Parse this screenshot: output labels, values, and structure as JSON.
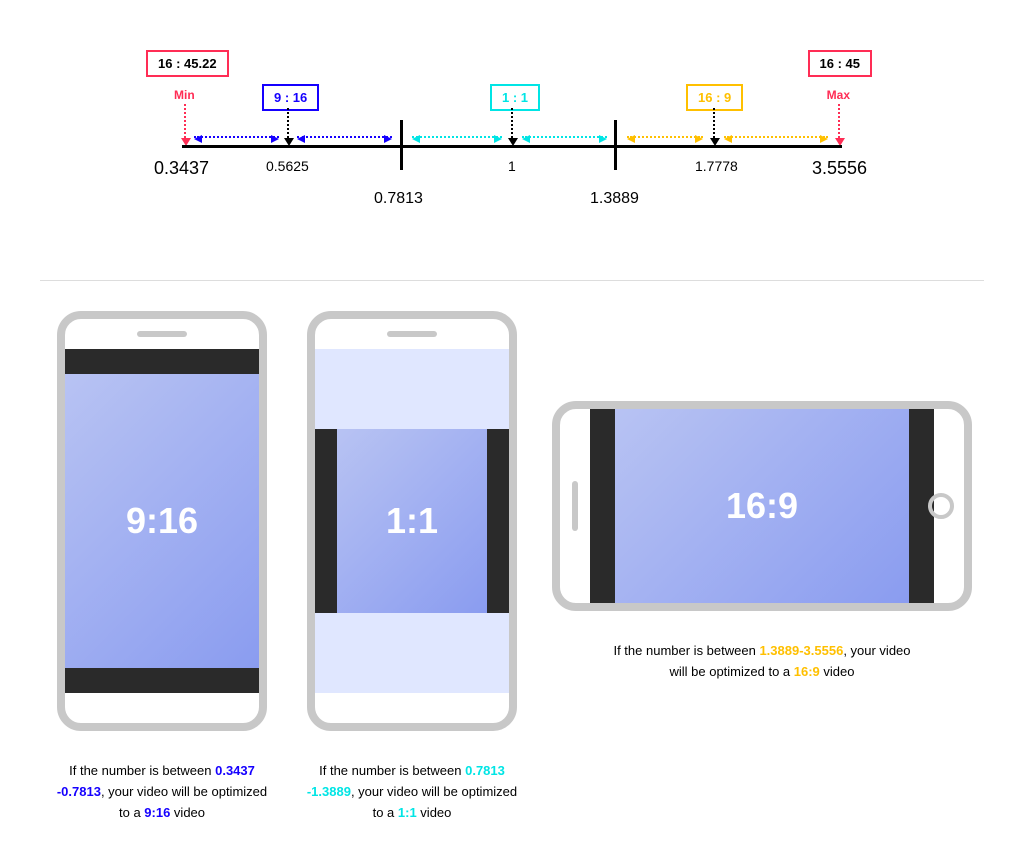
{
  "numberline": {
    "min_box": "16 : 45.22",
    "max_box": "16 : 45",
    "min_label": "Min",
    "max_label": "Max",
    "ratio_916": "9 : 16",
    "ratio_11": "1 : 1",
    "ratio_169": "16 : 9",
    "val_min": "0.3437",
    "val_916": "0.5625",
    "val_b1": "0.7813",
    "val_11": "1",
    "val_b2": "1.3889",
    "val_169": "1.7778",
    "val_max": "3.5556"
  },
  "phones": {
    "p1_label": "9:16",
    "p2_label": "1:1",
    "p3_label": "16:9"
  },
  "captions": {
    "c1_pre": "If the number is between",
    "c1_range": "0.3437 -0.7813",
    "c1_mid": ", your video will be optimized to a ",
    "c1_ratio": "9:16",
    "c1_post": " video",
    "c2_pre": "If the number is between",
    "c2_range": "0.7813 -1.3889",
    "c2_mid": ", your video will be optimized to a ",
    "c2_ratio": "1:1",
    "c2_post": " video",
    "c3_pre": "If the number is between",
    "c3_range": "1.3889-3.5556",
    "c3_mid": ", your video will be optimized to a ",
    "c3_ratio": "16:9",
    "c3_post": " video"
  },
  "colors": {
    "pink": "#ff2d55",
    "blue": "#1500ff",
    "cyan": "#00e5e5",
    "yellow": "#ffc000"
  }
}
